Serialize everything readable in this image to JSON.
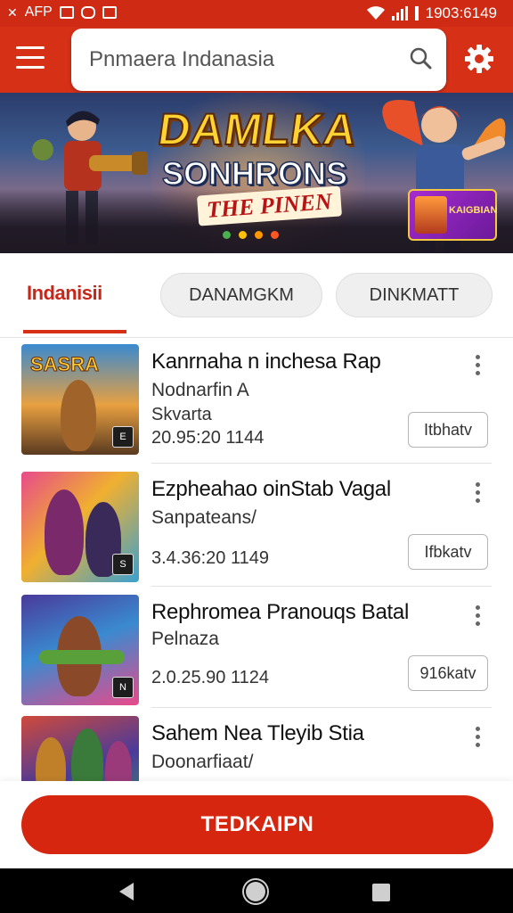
{
  "status_bar": {
    "left_text": "AFP",
    "right_text": "1903:6149"
  },
  "search": {
    "placeholder": "Pnmaera Indanasia"
  },
  "banner": {
    "title_line1": "DAMLKA",
    "title_line2": "SONHRONS",
    "title_line3": "THE PINEN",
    "badge_text": "KAIGBIAN",
    "dots": 4,
    "dot_colors": [
      "#4caf50",
      "#ffc107",
      "#ff9800",
      "#ff5722"
    ]
  },
  "tabs": [
    {
      "label": "Indanisii",
      "active": true
    },
    {
      "label": "DANAMGKM",
      "active": false
    },
    {
      "label": "DINKMATT",
      "active": false
    }
  ],
  "list": [
    {
      "title": "Kanrnaha n inchesa Rap",
      "lines": [
        "Nodnarfin A",
        "Skvarta",
        "20.95:20 1144"
      ],
      "button": "Itbhatv",
      "thumb_text": "SASRA",
      "tag": "E"
    },
    {
      "title": "Ezpheahao oinStab Vagal",
      "lines": [
        "Sanpateans/",
        "3.4.36:20 1149"
      ],
      "button": "Ifbkatv",
      "thumb_text": "",
      "tag": "S"
    },
    {
      "title": "Rephromea Pranouqs Batal",
      "lines": [
        "Pelnaza",
        "2.0.25.90 1124"
      ],
      "button": "916katv",
      "thumb_text": "",
      "tag": "N"
    },
    {
      "title": "Sahem Nea Tleyib Stia",
      "lines": [
        "Doonarfiaat/"
      ],
      "button": "",
      "thumb_text": "",
      "tag": ""
    }
  ],
  "cta": {
    "label": "TEDKAIPN"
  },
  "colors": {
    "brand_red": "#d63017",
    "cta_red": "#d6260f",
    "active_tab": "#c9261a"
  }
}
